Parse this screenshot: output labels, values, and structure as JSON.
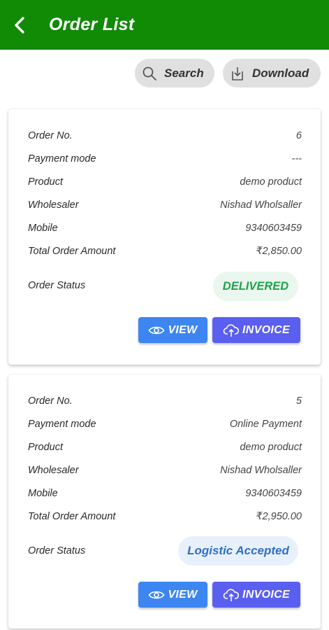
{
  "header": {
    "title": "Order List"
  },
  "toolbar": {
    "search_label": "Search",
    "download_label": "Download"
  },
  "labels": {
    "order_no": "Order No.",
    "payment_mode": "Payment mode",
    "product": "Product",
    "wholesaler": "Wholesaler",
    "mobile": "Mobile",
    "total": "Total Order Amount",
    "status": "Order Status",
    "view": "VIEW",
    "invoice": "INVOICE"
  },
  "orders": [
    {
      "order_no": "6",
      "payment_mode": "---",
      "product": "demo product",
      "wholesaler": "Nishad Wholsaller",
      "mobile": "9340603459",
      "total": "₹2,850.00",
      "status": "DELIVERED",
      "status_color": "#1fa24a"
    },
    {
      "order_no": "5",
      "payment_mode": "Online Payment",
      "product": "demo product",
      "wholesaler": "Nishad Wholsaller",
      "mobile": "9340603459",
      "total": "₹2,950.00",
      "status": "Logistic Accepted",
      "status_color": "#2f6fca"
    }
  ],
  "colors": {
    "app_bar": "#118a05",
    "view_button": "#3d86f2",
    "invoice_button": "#5b5ff0"
  },
  "icons": {
    "back": "arrow-left-icon",
    "search": "search-icon",
    "download": "download-icon",
    "view": "eye-icon",
    "invoice": "cloud-upload-icon"
  }
}
